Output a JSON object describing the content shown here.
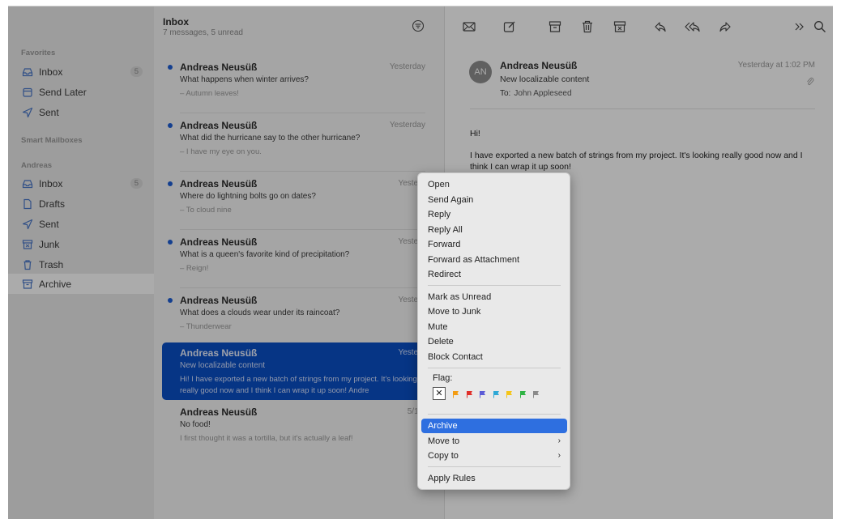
{
  "sidebar": {
    "sections": [
      "Favorites",
      "Smart Mailboxes",
      "Andreas"
    ],
    "favorites": [
      {
        "label": "Inbox",
        "icon": "inbox-icon",
        "badge": "5"
      },
      {
        "label": "Send Later",
        "icon": "calendar-icon"
      },
      {
        "label": "Sent",
        "icon": "paperplane-icon"
      }
    ],
    "account": [
      {
        "label": "Inbox",
        "icon": "inbox-icon",
        "badge": "5"
      },
      {
        "label": "Drafts",
        "icon": "document-icon"
      },
      {
        "label": "Sent",
        "icon": "paperplane-icon"
      },
      {
        "label": "Junk",
        "icon": "junk-icon"
      },
      {
        "label": "Trash",
        "icon": "trash-icon"
      },
      {
        "label": "Archive",
        "icon": "archive-icon",
        "selected": true
      }
    ]
  },
  "list": {
    "title": "Inbox",
    "subtitle": "7 messages, 5 unread",
    "messages": [
      {
        "from": "Andreas Neusüß",
        "date": "Yesterday",
        "subject": "What happens when winter arrives?",
        "preview": "– Autumn leaves!",
        "unread": true
      },
      {
        "from": "Andreas Neusüß",
        "date": "Yesterday",
        "subject": "What did the hurricane say to the other hurricane?",
        "preview": "– I have my eye on you.",
        "unread": true
      },
      {
        "from": "Andreas Neusüß",
        "date": "Yesterd",
        "subject": "Where do lightning bolts go on dates?",
        "preview": "– To cloud nine",
        "unread": true
      },
      {
        "from": "Andreas Neusüß",
        "date": "Yesterd",
        "subject": "What is a queen's favorite kind of precipitation?",
        "preview": "– Reign!",
        "unread": true
      },
      {
        "from": "Andreas Neusüß",
        "date": "Yesterd",
        "subject": "What does a clouds wear under its raincoat?",
        "preview": "– Thunderwear",
        "unread": true
      },
      {
        "from": "Andreas Neusüß",
        "date": "Yesterd",
        "subject": "New localizable content",
        "preview": "Hi! I have exported a new batch of strings from my project. It's looking really good now and I think I can wrap it up soon! Andre",
        "selected": true
      },
      {
        "from": "Andreas Neusüß",
        "date": "5/12/",
        "subject": "No food!",
        "preview": "I first thought it was a tortilla, but it's actually a leaf!"
      }
    ]
  },
  "toolbar": {
    "icons": [
      "envelope-icon",
      "compose-icon",
      "archive-icon",
      "trash-icon",
      "junk-icon",
      "reply-icon",
      "reply-all-icon",
      "forward-icon",
      "more-icon",
      "search-icon"
    ]
  },
  "reader": {
    "avatar": "AN",
    "from": "Andreas Neusüß",
    "date": "Yesterday at 1:02 PM",
    "subject": "New localizable content",
    "to_label": "To:",
    "to": "John Appleseed",
    "greeting": "Hi!",
    "body": "I have exported a new batch of strings from my project. It's looking really good now and I think I can wrap it up soon!"
  },
  "menu": {
    "group1": [
      "Open",
      "Send Again",
      "Reply",
      "Reply All",
      "Forward",
      "Forward as Attachment",
      "Redirect"
    ],
    "group2": [
      "Mark as Unread",
      "Move to Junk",
      "Mute",
      "Delete",
      "Block Contact"
    ],
    "flag_label": "Flag:",
    "flag_clear": "✕",
    "flag_colors": [
      "#f39c12",
      "#e0302a",
      "#5b5bd6",
      "#2ea8d6",
      "#f5c518",
      "#2fb344",
      "#8a8a8a"
    ],
    "group3": [
      "Archive",
      "Move to",
      "Copy to"
    ],
    "group4": [
      "Apply Rules"
    ],
    "highlighted": "Archive",
    "submenu_chevron": "›"
  }
}
